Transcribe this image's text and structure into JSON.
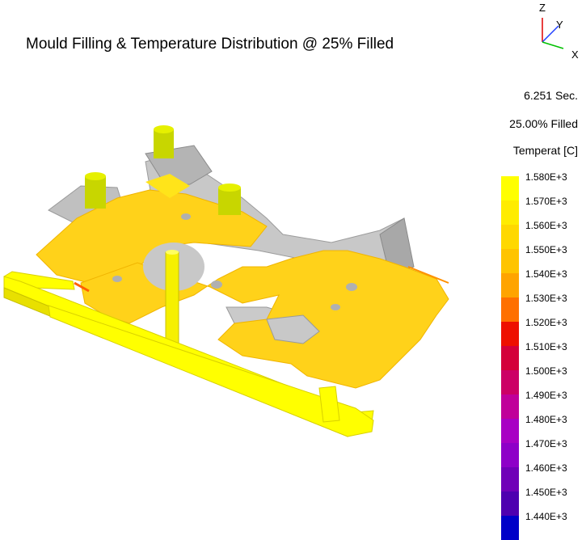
{
  "title": "Mould Filling & Temperature Distribution @ 25% Filled",
  "axes": {
    "z": "Z",
    "y": "Y",
    "x": "X"
  },
  "time": "6.251 Sec.",
  "fill": "25.00% Filled",
  "legend": {
    "title": "Temperat [C]",
    "ticks": [
      "1.580E+3",
      "1.570E+3",
      "1.560E+3",
      "1.550E+3",
      "1.540E+3",
      "1.530E+3",
      "1.520E+3",
      "1.510E+3",
      "1.500E+3",
      "1.490E+3",
      "1.480E+3",
      "1.470E+3",
      "1.460E+3",
      "1.450E+3",
      "1.440E+3"
    ],
    "colors": [
      "#ffff00",
      "#ffec00",
      "#ffd800",
      "#ffc400",
      "#ffa400",
      "#ff7000",
      "#ee1000",
      "#d4003a",
      "#cc0066",
      "#c0009a",
      "#a800c4",
      "#8e00c8",
      "#7000b8",
      "#4e00b0",
      "#0000c8"
    ]
  },
  "colors": {
    "metal": "#ffd21a",
    "metal_hot": "#ffe41a",
    "runner": "#ffff00",
    "riser": "#c8d600",
    "mould_gray": "#c8c8c8",
    "mould_dark": "#9c9c9c"
  }
}
